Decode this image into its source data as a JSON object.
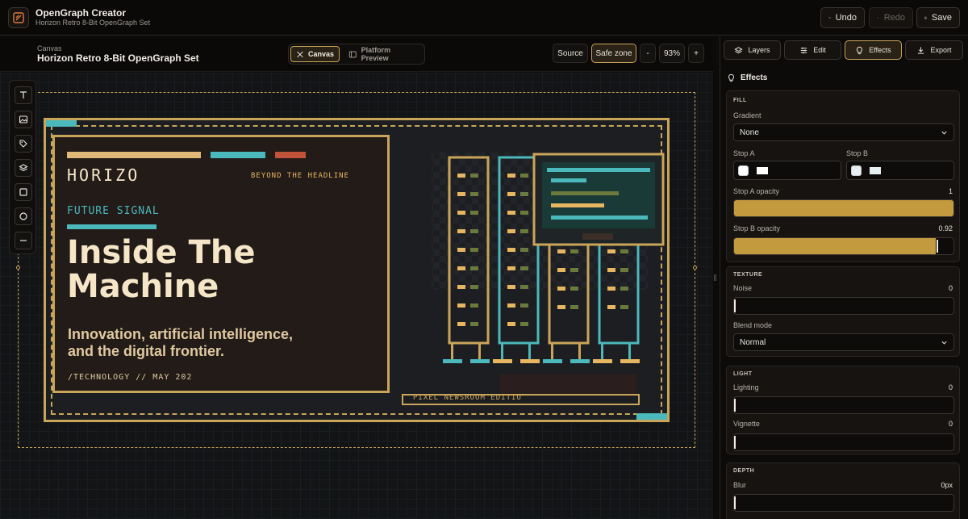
{
  "app": {
    "title": "OpenGraph Creator",
    "subtitle": "Horizon Retro 8-Bit OpenGraph Set"
  },
  "top_actions": {
    "undo": "Undo",
    "redo": "Redo",
    "save": "Save"
  },
  "canvas_header": {
    "label": "Canvas",
    "title": "Horizon Retro 8-Bit OpenGraph Set",
    "view_tabs": [
      "Canvas",
      "Platform Preview"
    ],
    "active_view": "Canvas",
    "source": "Source",
    "safe_zone": "Safe zone",
    "zoom_minus": "-",
    "zoom": "93%",
    "zoom_plus": "+"
  },
  "tools": [
    "text-tool-icon",
    "image-tool-icon",
    "tag-tool-icon",
    "layers-tool-icon",
    "rectangle-tool-icon",
    "circle-tool-icon",
    "line-tool-icon"
  ],
  "og_card": {
    "brand": "HORIZO",
    "tagline": "BEYOND THE HEADLINE",
    "kicker": "FUTURE SIGNAL",
    "headline_1": "Inside The",
    "headline_2": "Machine",
    "subline": "Innovation, artificial intelligence, and the digital frontier.",
    "meta": "/TECHNOLOGY // MAY 202",
    "edition": "PIXEL NEWSROOM EDITIO",
    "colors": {
      "gold": "#c9a55a",
      "teal": "#4bb8bb",
      "red": "#c0533a",
      "cream": "#f5e6c8",
      "card_bg": "#221b18"
    }
  },
  "panel": {
    "tabs": [
      "Layers",
      "Edit",
      "Effects",
      "Export"
    ],
    "active_tab": "Effects",
    "effects_title": "Effects",
    "fill": {
      "heading": "FILL",
      "gradient_label": "Gradient",
      "gradient_value": "None",
      "stop_a_label": "Stop A",
      "stop_b_label": "Stop B",
      "stop_a_opacity_label": "Stop A opacity",
      "stop_a_opacity": "1",
      "stop_b_opacity_label": "Stop B opacity",
      "stop_b_opacity": "0.92"
    },
    "texture": {
      "heading": "TEXTURE",
      "noise_label": "Noise",
      "noise": "0",
      "blend_label": "Blend mode",
      "blend_value": "Normal"
    },
    "light": {
      "heading": "LIGHT",
      "lighting_label": "Lighting",
      "lighting": "0",
      "vignette_label": "Vignette",
      "vignette": "0"
    },
    "depth": {
      "heading": "DEPTH",
      "blur_label": "Blur",
      "blur": "0px"
    }
  }
}
